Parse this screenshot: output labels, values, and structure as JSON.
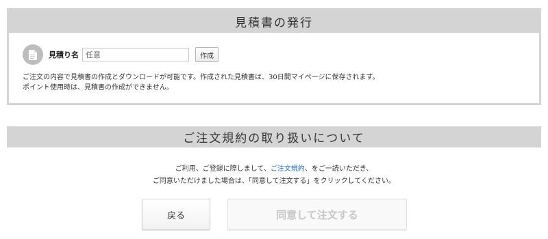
{
  "quote": {
    "header": "見積書の発行",
    "label": "見積り名",
    "input_value": "",
    "input_placeholder": "任意",
    "create_label": "作成",
    "note_line1": "ご注文の内容で見積書の作成とダウンロードが可能です。作成された見積書は、30日間マイページに保存されます。",
    "note_line2": "ポイント使用時は、見積書の作成ができません。",
    "icon": "document-icon"
  },
  "terms": {
    "header": "ご注文規約の取り扱いについて",
    "text_before": "ご利用、ご登録に際しまして、",
    "link_label": "ご注文規約",
    "text_after": "、をご一読いただき、",
    "line2": "ご同意いただけました場合は、「同意して注文する」をクリックしてください。"
  },
  "buttons": {
    "back_label": "戻る",
    "agree_label": "同意して注文する"
  },
  "colors": {
    "header_bg": "#d4d4d4",
    "link": "#2a6fc1",
    "agree_text_disabled": "#c6c6c6"
  }
}
